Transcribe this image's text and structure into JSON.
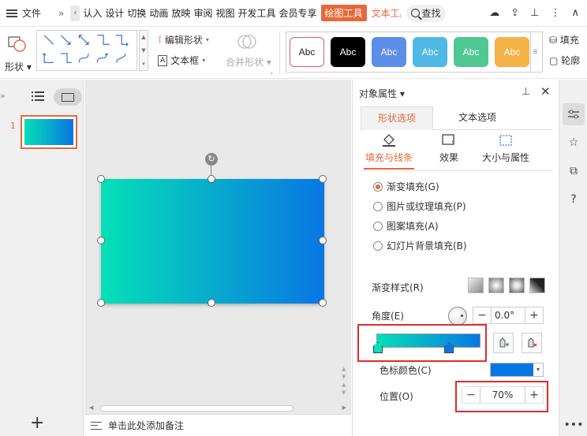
{
  "menubar": {
    "file": "文件",
    "more": "»",
    "collapse": "‹",
    "tabs": [
      "认入",
      "设计",
      "切换",
      "动画",
      "放映",
      "审阅",
      "视图",
      "开发工具",
      "会员专享"
    ],
    "active_tab": "绘图工具",
    "text_tool_tab": "文本工具",
    "search": "查找",
    "first_tab_visible": "认入"
  },
  "ribbon": {
    "shape_label": "形状",
    "edit_shape": "编辑形状",
    "textbox": "文本框",
    "merge_shape": "合并形状",
    "style_tiles": [
      {
        "text": "Abc",
        "bg": "#ffffff",
        "fg": "#222222",
        "border": "#e05a6a"
      },
      {
        "text": "Abc",
        "bg": "#000000",
        "fg": "#ffffff",
        "border": "#000000"
      },
      {
        "text": "Abc",
        "bg": "#5b8ee6",
        "fg": "#ffffff",
        "border": "#5b8ee6"
      },
      {
        "text": "Abc",
        "bg": "#4fb8e6",
        "fg": "#ffffff",
        "border": "#4fb8e6"
      },
      {
        "text": "Abc",
        "bg": "#4fc792",
        "fg": "#ffffff",
        "border": "#4fc792"
      },
      {
        "text": "Abc",
        "bg": "#f5b246",
        "fg": "#ffffff",
        "border": "#f5b246"
      }
    ],
    "fill": "填充",
    "outline": "轮廓"
  },
  "slides": {
    "number": "1",
    "add": "+"
  },
  "canvas": {
    "gradient_start": "#06dfb7",
    "gradient_end": "#0877e3"
  },
  "notes": {
    "placeholder": "单击此处添加备注"
  },
  "props": {
    "title": "对象属性",
    "tab_shape": "形状选项",
    "tab_text": "文本选项",
    "subtab_fill": "填充与线条",
    "subtab_effect": "效果",
    "subtab_size": "大小与属性",
    "radio_gradient": "渐变填充(G)",
    "radio_picture": "图片或纹理填充(P)",
    "radio_pattern": "图案填充(A)",
    "radio_slide_bg": "幻灯片背景填充(B)",
    "gradient_style_label": "渐变样式(R)",
    "angle_label": "角度(E)",
    "angle_value": "0.0°",
    "stop_color_label": "色标颜色(C)",
    "stop_color": "#0877e3",
    "position_label": "位置(O)",
    "position_value": "70%",
    "accent": "#e8683a",
    "highlight": "#e02b2b"
  }
}
